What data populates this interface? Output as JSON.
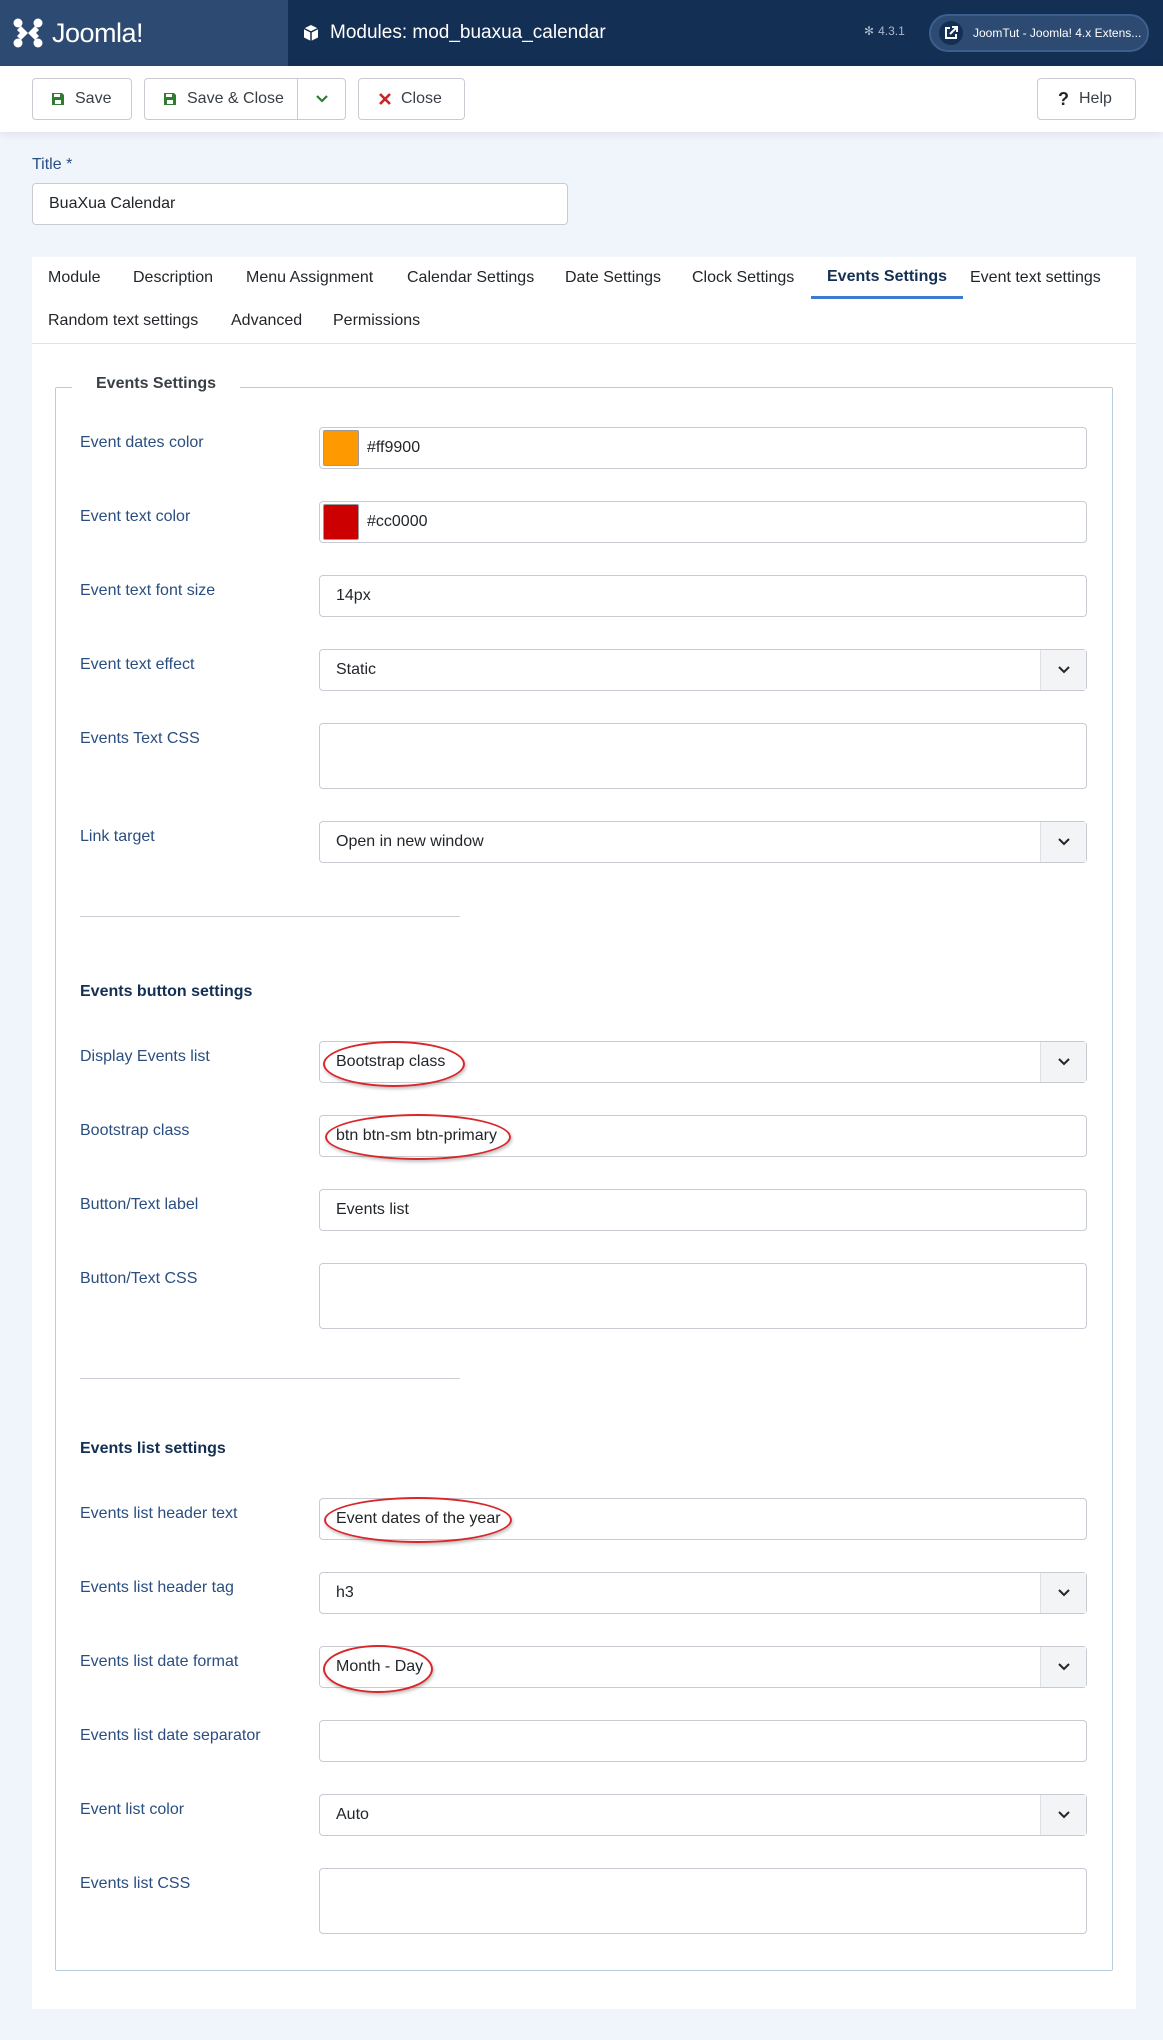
{
  "header": {
    "brand": "Joomla!",
    "page_title": "Modules: mod_buaxua_calendar",
    "version": "4.3.1",
    "site_link": "JoomTut - Joomla! 4.x Extens..."
  },
  "toolbar": {
    "save": "Save",
    "save_close": "Save & Close",
    "close": "Close",
    "help": "Help"
  },
  "title_field": {
    "label": "Title *",
    "value": "BuaXua Calendar"
  },
  "tabs": [
    {
      "label": "Module"
    },
    {
      "label": "Description"
    },
    {
      "label": "Menu Assignment"
    },
    {
      "label": "Calendar Settings"
    },
    {
      "label": "Date Settings"
    },
    {
      "label": "Clock Settings"
    },
    {
      "label": "Events Settings",
      "active": true
    },
    {
      "label": "Event text settings"
    },
    {
      "label": "Random text settings"
    },
    {
      "label": "Advanced"
    },
    {
      "label": "Permissions"
    }
  ],
  "fieldset": {
    "legend": "Events Settings",
    "event_dates_color": {
      "label": "Event dates color",
      "value": "#ff9900",
      "color": "#ff9900"
    },
    "event_text_color": {
      "label": "Event text color",
      "value": "#cc0000",
      "color": "#cc0000"
    },
    "event_text_font_size": {
      "label": "Event text font size",
      "value": "14px"
    },
    "event_text_effect": {
      "label": "Event text effect",
      "value": "Static"
    },
    "events_text_css": {
      "label": "Events Text CSS",
      "value": ""
    },
    "link_target": {
      "label": "Link target",
      "value": "Open in new window"
    },
    "button_settings": {
      "heading": "Events button settings",
      "display_events_list": {
        "label": "Display Events list",
        "value": "Bootstrap class"
      },
      "bootstrap_class": {
        "label": "Bootstrap class",
        "value": "btn btn-sm btn-primary"
      },
      "button_text_label": {
        "label": "Button/Text label",
        "value": "Events list"
      },
      "button_text_css": {
        "label": "Button/Text CSS",
        "value": ""
      }
    },
    "list_settings": {
      "heading": "Events list settings",
      "header_text": {
        "label": "Events list header text",
        "value": "Event dates of the year"
      },
      "header_tag": {
        "label": "Events list header tag",
        "value": "h3"
      },
      "date_format": {
        "label": "Events list date format",
        "value": "Month - Day"
      },
      "date_separator": {
        "label": "Events list date separator",
        "value": ""
      },
      "event_list_color": {
        "label": "Event list color",
        "value": "Auto"
      },
      "events_list_css": {
        "label": "Events list CSS",
        "value": ""
      }
    }
  },
  "colors": {
    "header_bg": "#132f53",
    "logo_bg": "#2c4a72",
    "save_icon": "#2f7d32",
    "close_icon": "#c62828",
    "annotation": "#d8262b"
  }
}
